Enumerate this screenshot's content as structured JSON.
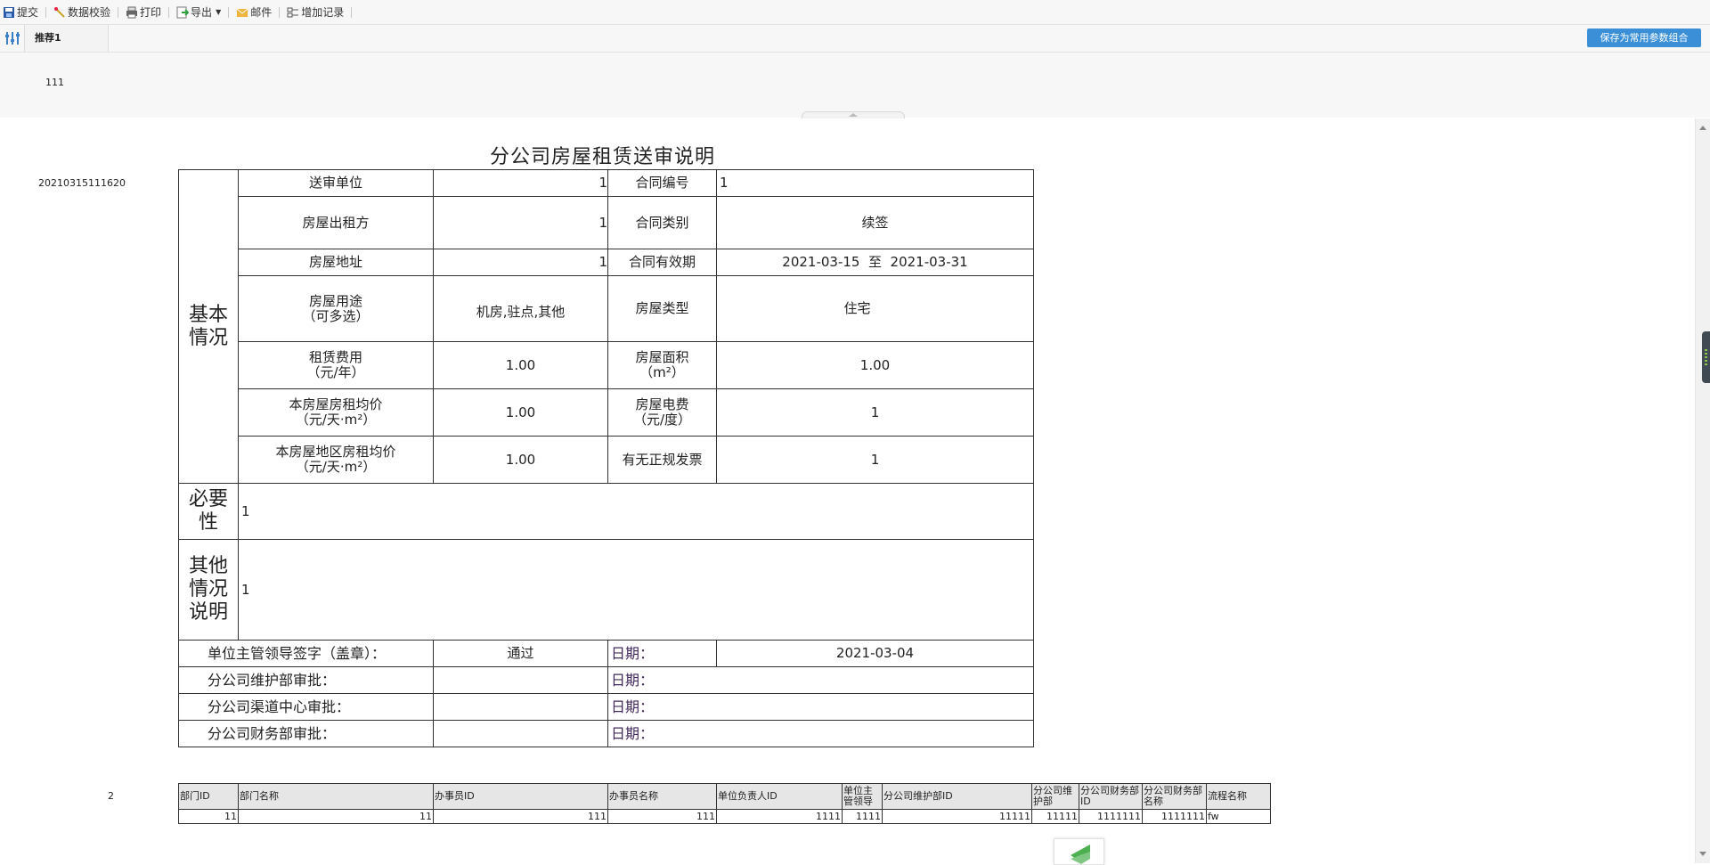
{
  "toolbar": {
    "items": [
      {
        "label": "提交",
        "icon": "save-icon"
      },
      {
        "label": "数据校验",
        "icon": "validate-icon"
      },
      {
        "label": "打印",
        "icon": "print-icon"
      },
      {
        "label": "导出",
        "icon": "export-icon"
      },
      {
        "label": "邮件",
        "icon": "mail-icon"
      },
      {
        "label": "增加记录",
        "icon": "add-record-icon"
      }
    ]
  },
  "params": {
    "tab_label": "推荐1",
    "save_label": "保存为常用参数组合",
    "value": "111"
  },
  "report": {
    "title": "分公司房屋租赁送审说明",
    "left_id": "20210315111620",
    "row_number": "2",
    "sections": {
      "basic": "基本情况",
      "necessity": "必要性",
      "other": "其他情况说明"
    },
    "fields": {
      "submit_unit_label": "送审单位",
      "submit_unit_value": "1",
      "contract_no_label": "合同编号",
      "contract_no_value": "1",
      "lessor_label": "房屋出租方",
      "lessor_value": "1",
      "contract_type_label": "合同类别",
      "contract_type_value": "续签",
      "address_label": "房屋地址",
      "address_value": "1",
      "validity_label": "合同有效期",
      "validity_value": "2021-03-15  至  2021-03-31",
      "usage_label_1": "房屋用途",
      "usage_label_2": "（可多选）",
      "usage_value": "机房,驻点,其他",
      "house_type_label": "房屋类型",
      "house_type_value": "住宅",
      "rent_label_1": "租赁费用",
      "rent_label_2": "（元/年）",
      "rent_value": "1.00",
      "area_label_1": "房屋面积",
      "area_label_2": "（m²）",
      "area_value": "1.00",
      "avg_label_1": "本房屋房租均价",
      "avg_label_2": "（元/天·m²）",
      "avg_value": "1.00",
      "elec_label_1": "房屋电费",
      "elec_label_2": "（元/度）",
      "elec_value": "1",
      "region_avg_label_1": "本房屋地区房租均价",
      "region_avg_label_2": "（元/天·m²）",
      "region_avg_value": "1.00",
      "invoice_label": "有无正规发票",
      "invoice_value": "1",
      "necessity_value": "1",
      "other_value": "1"
    },
    "approvals": [
      {
        "label": "单位主管领导签字（盖章）：",
        "result": "通过",
        "date_label": "日期：",
        "date": "2021-03-04"
      },
      {
        "label": "分公司维护部审批：",
        "result": "",
        "date_label": "日期：",
        "date": ""
      },
      {
        "label": "分公司渠道中心审批：",
        "result": "",
        "date_label": "日期：",
        "date": ""
      },
      {
        "label": "分公司财务部审批：",
        "result": "",
        "date_label": "日期：",
        "date": ""
      }
    ]
  },
  "data_table": {
    "headers": [
      "部门ID",
      "部门名称",
      "办事员ID",
      "办事员名称",
      "单位负责人ID",
      "单位主管领导",
      "分公司维护部ID",
      "分公司维护部",
      "分公司财务部ID",
      "分公司财务部名称",
      "流程名称"
    ],
    "row": [
      "11",
      "11",
      "111",
      "111",
      "1111",
      "1111",
      "11111",
      "11111",
      "1111111",
      "1111111",
      "fw"
    ]
  }
}
